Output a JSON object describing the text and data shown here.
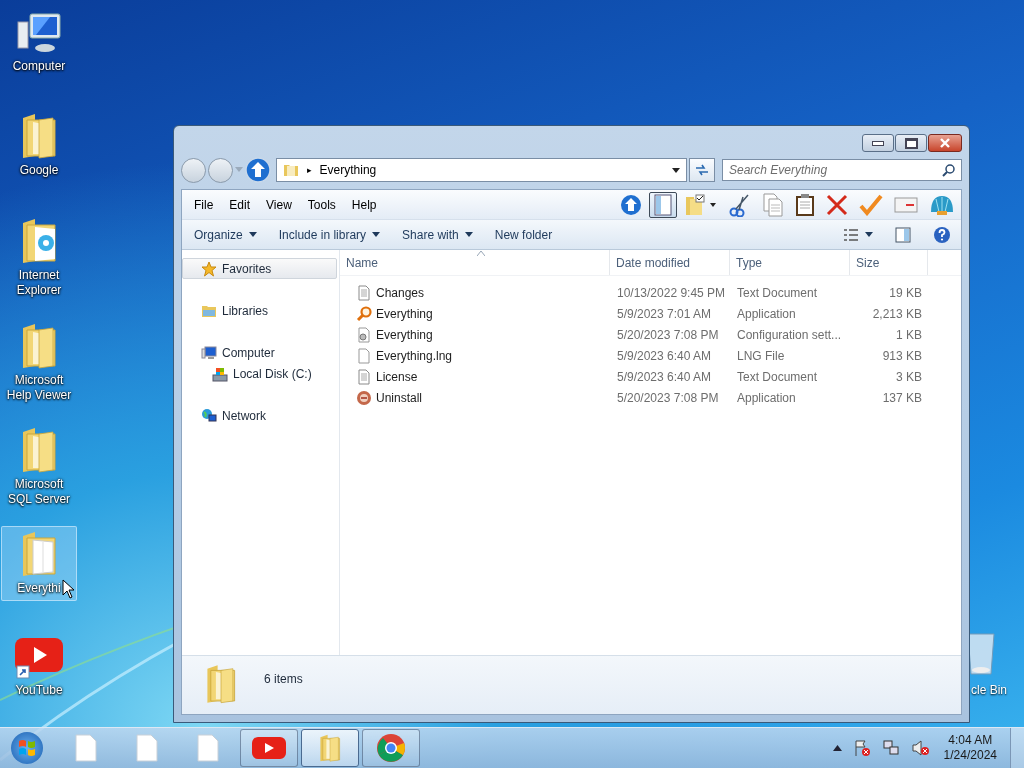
{
  "desktop_icons": [
    {
      "label": "Computer",
      "kind": "computer",
      "selected": false
    },
    {
      "label": "Google",
      "kind": "folder",
      "selected": false
    },
    {
      "label": "Internet Explorer",
      "kind": "folder-ie",
      "selected": false
    },
    {
      "label": "Microsoft Help Viewer",
      "kind": "folder",
      "selected": false
    },
    {
      "label": "Microsoft SQL Server",
      "kind": "folder",
      "selected": false
    },
    {
      "label": "Everythi",
      "kind": "folder-doc",
      "selected": true
    },
    {
      "label": "YouTube",
      "kind": "youtube",
      "selected": false
    }
  ],
  "recycle_bin": {
    "label": "cle Bin"
  },
  "window": {
    "address": {
      "separator": "▸",
      "location": "Everything"
    },
    "search": {
      "placeholder": "Search Everything"
    },
    "menu": [
      "File",
      "Edit",
      "View",
      "Tools",
      "Help"
    ],
    "toolbar": [
      {
        "kind": "up",
        "selected": false
      },
      {
        "kind": "preview",
        "selected": true
      },
      {
        "kind": "folder-check",
        "selected": false
      },
      {
        "kind": "cut",
        "selected": false
      },
      {
        "kind": "copy",
        "selected": false
      },
      {
        "kind": "paste",
        "selected": false
      },
      {
        "kind": "delete",
        "selected": false
      },
      {
        "kind": "check",
        "selected": false
      },
      {
        "kind": "mail",
        "selected": false
      },
      {
        "kind": "shell",
        "selected": false
      }
    ],
    "commands": [
      {
        "label": "Organize",
        "dropdown": true
      },
      {
        "label": "Include in library",
        "dropdown": true
      },
      {
        "label": "Share with",
        "dropdown": true
      },
      {
        "label": "New folder",
        "dropdown": false
      }
    ],
    "nav": [
      {
        "label": "Favorites",
        "kind": "star",
        "selected": true
      },
      {
        "label": "Libraries",
        "kind": "library",
        "selected": false
      },
      {
        "label": "Computer",
        "kind": "computer",
        "selected": false,
        "children": [
          {
            "label": "Local Disk (C:)",
            "kind": "disk",
            "selected": false
          }
        ]
      },
      {
        "label": "Network",
        "kind": "network",
        "selected": false
      }
    ],
    "columns": [
      "Name",
      "Date modified",
      "Type",
      "Size"
    ],
    "files": [
      {
        "name": "Changes",
        "date": "10/13/2022 9:45 PM",
        "type": "Text Document",
        "size": "19 KB",
        "kind": "text"
      },
      {
        "name": "Everything",
        "date": "5/9/2023 7:01 AM",
        "type": "Application",
        "size": "2,213 KB",
        "kind": "search-app"
      },
      {
        "name": "Everything",
        "date": "5/20/2023 7:08 PM",
        "type": "Configuration sett...",
        "size": "1 KB",
        "kind": "config"
      },
      {
        "name": "Everything.lng",
        "date": "5/9/2023 6:40 AM",
        "type": "LNG File",
        "size": "913 KB",
        "kind": "file"
      },
      {
        "name": "License",
        "date": "5/9/2023 6:40 AM",
        "type": "Text Document",
        "size": "3 KB",
        "kind": "text"
      },
      {
        "name": "Uninstall",
        "date": "5/20/2023 7:08 PM",
        "type": "Application",
        "size": "137 KB",
        "kind": "uninstall-app"
      }
    ],
    "status": "6 items"
  },
  "taskbar": {
    "items": [
      {
        "kind": "document",
        "selected": false
      },
      {
        "kind": "document",
        "selected": false
      },
      {
        "kind": "document",
        "selected": false
      },
      {
        "kind": "youtube",
        "selected": false
      },
      {
        "kind": "folder",
        "selected": true
      },
      {
        "kind": "chrome",
        "selected": false
      }
    ],
    "time": "4:04 AM",
    "date": "1/24/2024"
  }
}
